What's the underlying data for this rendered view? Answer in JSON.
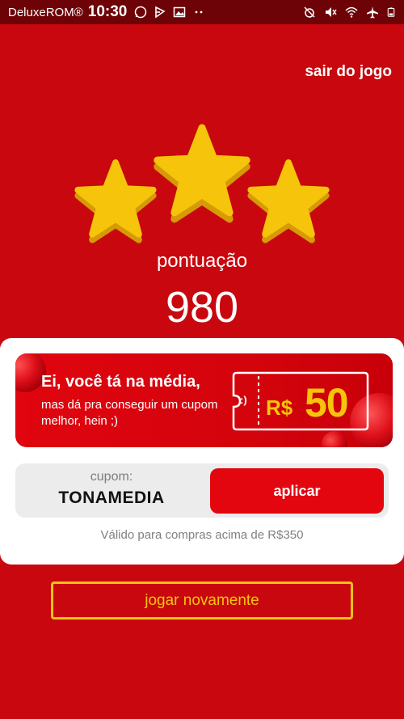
{
  "status_bar": {
    "carrier": "DeluxeROM®",
    "time": "10:30"
  },
  "header": {
    "exit_label": "sair do jogo"
  },
  "result": {
    "stars_earned": 3,
    "stars_total": 3,
    "score_label": "pontuação",
    "score_value": "980"
  },
  "promo": {
    "headline": "Ei, você tá na média,",
    "subtext": "mas dá pra conseguir um cupom melhor, hein ;)",
    "ticket_smile": ":)",
    "currency": "R$",
    "amount": "50"
  },
  "coupon": {
    "label": "cupom:",
    "code": "TONAMEDIA",
    "apply_label": "aplicar",
    "validity": "Válido para compras acima de R$350"
  },
  "actions": {
    "replay_label": "jogar novamente"
  },
  "colors": {
    "background": "#c8080e",
    "status_bar": "#6e0307",
    "star": "#f6c40b",
    "accent_red": "#e3060f",
    "replay_border": "#f2c214"
  }
}
